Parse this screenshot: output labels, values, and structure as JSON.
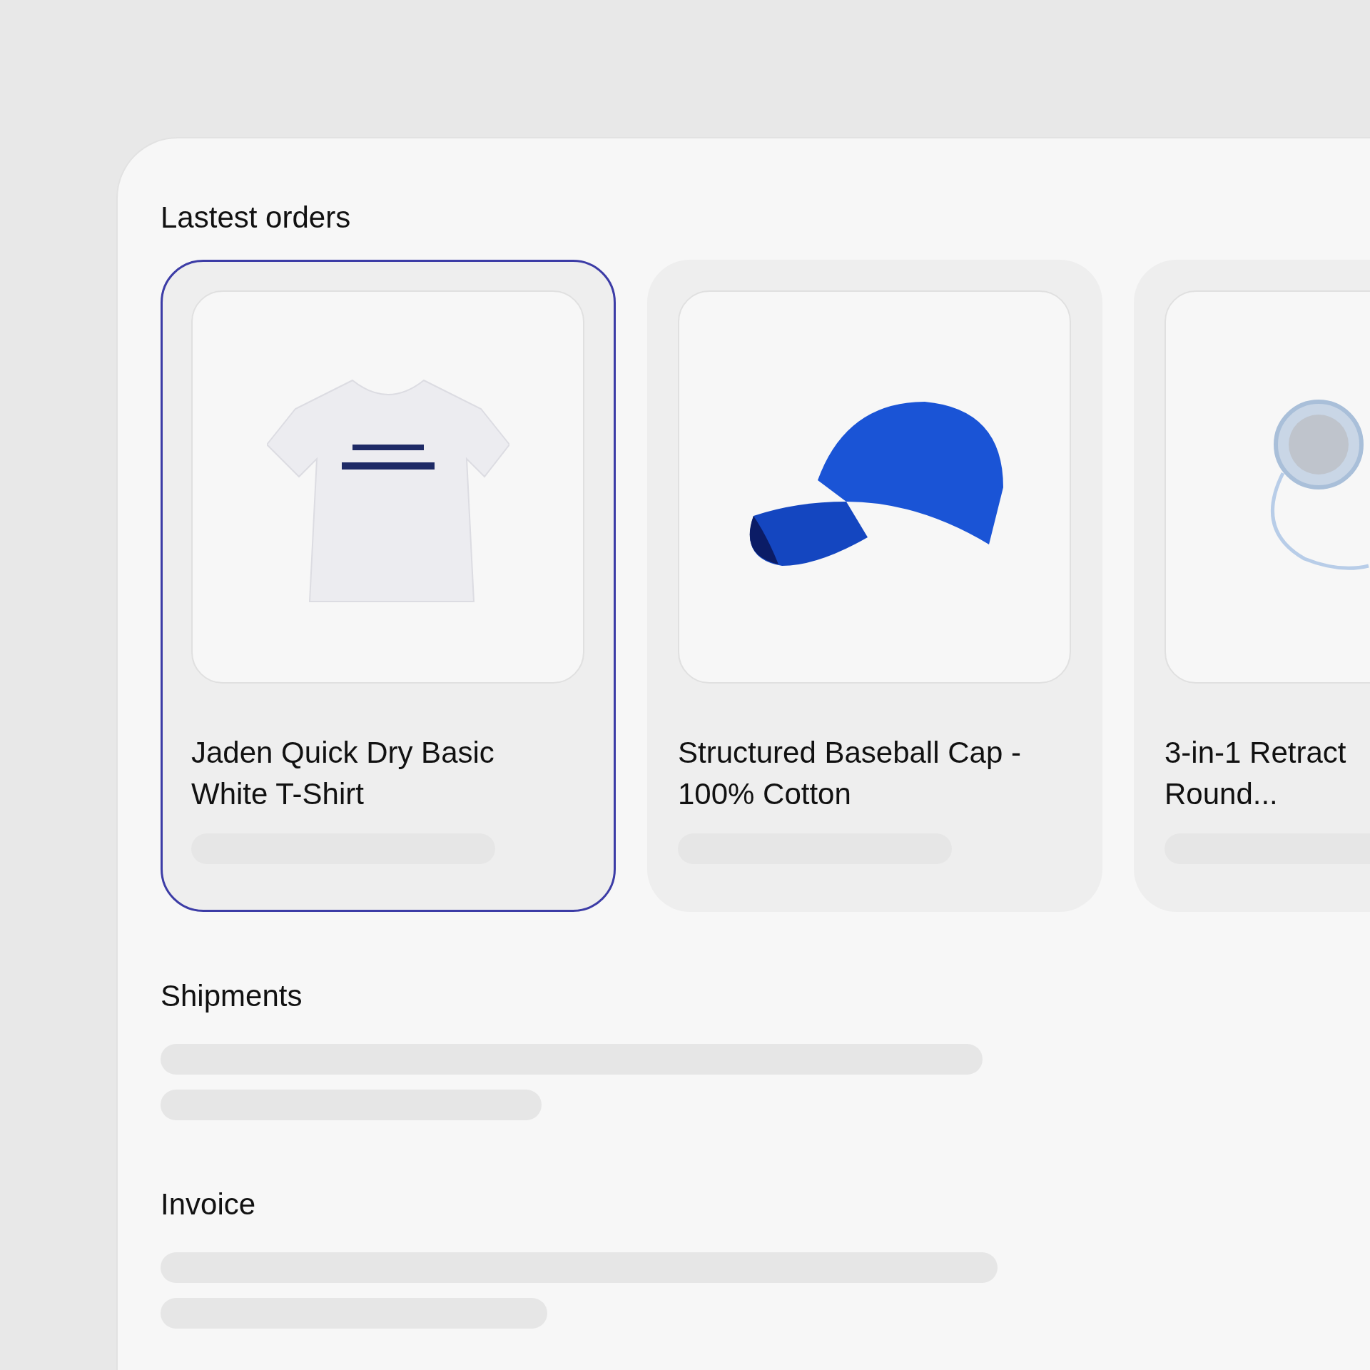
{
  "latest_orders": {
    "title": "Lastest orders",
    "orders": [
      {
        "kind": "tshirt",
        "name_lines": [
          "Jaden Quick Dry Basic",
          "White T-Shirt"
        ],
        "selected": true
      },
      {
        "kind": "cap",
        "name_lines": [
          "Structured Baseball Cap -",
          "100% Cotton"
        ],
        "selected": false
      },
      {
        "kind": "device",
        "name_lines": [
          "3-in-1 Retract",
          "Round..."
        ],
        "selected": false
      }
    ]
  },
  "shipments": {
    "title": "Shipments"
  },
  "invoice": {
    "title": "Invoice"
  }
}
